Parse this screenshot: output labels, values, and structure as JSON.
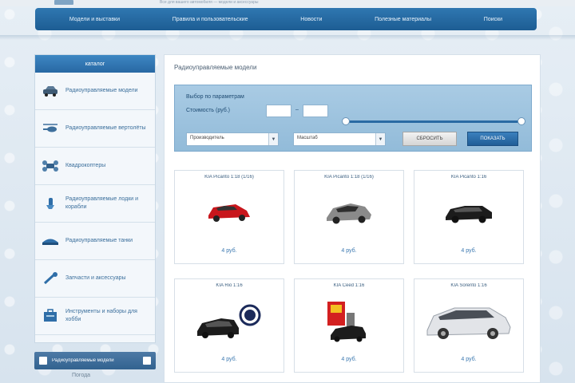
{
  "header": {
    "tagline": "Все для вашего автомобиля — модели и аксессуары"
  },
  "nav": {
    "items": [
      {
        "label": "Модели и выставки",
        "active": false
      },
      {
        "label": "Правила и пользовательские",
        "active": false
      },
      {
        "label": "Новости",
        "active": false
      },
      {
        "label": "Полезные материалы",
        "active": false
      },
      {
        "label": "Поиски",
        "active": false
      }
    ]
  },
  "sidebar": {
    "title": "каталог",
    "items": [
      {
        "label": "Радиоуправляемые модели",
        "icon": "car-icon"
      },
      {
        "label": "Радиоуправляемые вертолёты",
        "icon": "helicopter-icon"
      },
      {
        "label": "Квадрокоптеры",
        "icon": "quadcopter-icon"
      },
      {
        "label": "Радиоуправляемые лодки и корабли",
        "icon": "boat-icon"
      },
      {
        "label": "Радиоуправляемые танки",
        "icon": "tank-icon"
      },
      {
        "label": "Запчасти и аксессуары",
        "icon": "wrench-icon"
      },
      {
        "label": "Инструменты и наборы для хобби",
        "icon": "toolbox-icon"
      }
    ],
    "bottom_label": "Радиоуправляемые модели",
    "footer": "Погода"
  },
  "main": {
    "title": "Радиоуправляемые модели",
    "filter": {
      "label1": "Выбор по параметрам",
      "label2": "Стоимость (руб.)",
      "price_from": "",
      "price_to": "",
      "select1": "Производитель",
      "select2": "Масштаб",
      "reset_label": "СБРОСИТЬ",
      "show_label": "ПОКАЗАТЬ"
    },
    "products": [
      {
        "title": "KIA Picanto 1:18 (1/16)",
        "price": "4 руб.",
        "color": "#c8161c"
      },
      {
        "title": "KIA Picanto 1:18 (1/16)",
        "price": "4 руб.",
        "color": "#8a8a8a"
      },
      {
        "title": "KIA Picanto 1:16",
        "price": "4 руб.",
        "color": "#1c1c1c"
      },
      {
        "title": "KIA Rio 1:16",
        "price": "4 руб.",
        "color": "#1c1c1c"
      },
      {
        "title": "KIA Ceed 1:16",
        "price": "4 руб.",
        "color": "#d32020"
      },
      {
        "title": "KIA Sorento 1:16",
        "price": "4 руб.",
        "color": "#e2e4e8"
      }
    ]
  }
}
